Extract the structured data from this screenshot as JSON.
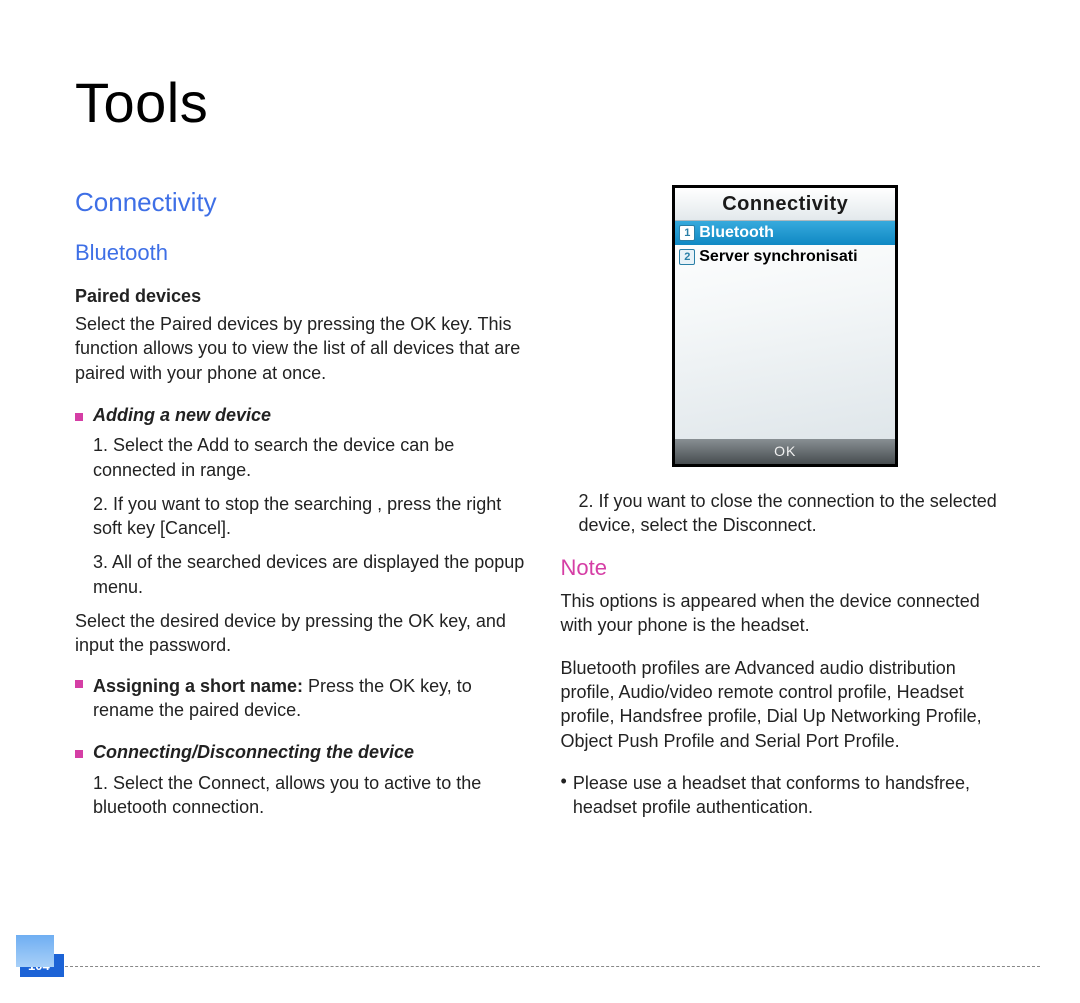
{
  "title": "Tools",
  "section": "Connectivity",
  "sub": "Bluetooth",
  "leftCol": {
    "pairedHeading": "Paired devices",
    "pairedText": "Select the Paired devices by pressing the OK key. This function allows you to view the list of all devices  that are paired with your phone at once.",
    "addHeading": "Adding a new device",
    "addSteps": [
      "1. Select the Add to search the device can be connected in range.",
      "2. If you want to stop the searching , press the right soft key [Cancel].",
      "3. All of the searched devices are displayed the popup menu."
    ],
    "selectDevice": "Select the desired device by pressing the OK key, and input the password.",
    "assignBold": "Assigning a short name:",
    "assignRest": " Press the OK key, to rename the paired device.",
    "connHeading": "Connecting/Disconnecting the device",
    "connStep1": "1. Select the Connect, allows you to active to the bluetooth connection."
  },
  "rightCol": {
    "connStep2": "2. If you want to close the connection to the selected device, select the Disconnect.",
    "noteHeading": "Note",
    "noteText1": "This options is appeared when the device connected with your phone is the headset.",
    "noteText2": "Bluetooth profiles are Advanced audio distribution profile, Audio/video remote control profile, Headset profile, Handsfree profile, Dial Up Networking Profile, Object Push Profile and Serial Port Profile.",
    "noteBullet": "Please use a headset that conforms to handsfree, headset profile authentication."
  },
  "phone": {
    "title": "Connectivity",
    "item1": "Bluetooth",
    "item2": "Server synchronisati",
    "ok": "OK"
  },
  "pageNumber": "104"
}
